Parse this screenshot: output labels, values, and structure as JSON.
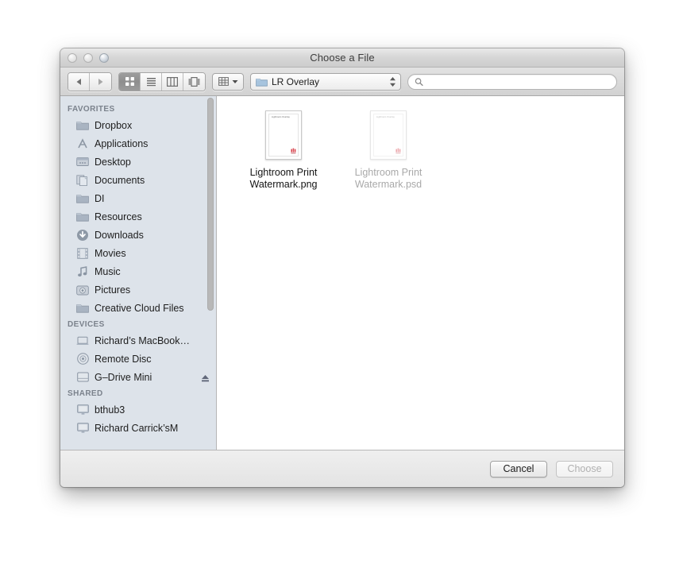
{
  "window": {
    "title": "Choose a File",
    "traffic_lights": [
      "close-button",
      "minimize-button",
      "zoom-button"
    ]
  },
  "toolbar": {
    "nav": {
      "back_icon": "back-arrow-icon",
      "forward_icon": "forward-arrow-icon"
    },
    "view_modes": [
      {
        "name": "icon-view",
        "icon": "grid-icon",
        "selected": true
      },
      {
        "name": "list-view",
        "icon": "list-icon",
        "selected": false
      },
      {
        "name": "column-view",
        "icon": "columns-icon",
        "selected": false
      },
      {
        "name": "coverflow-view",
        "icon": "coverflow-icon",
        "selected": false
      }
    ],
    "arrange": {
      "icon": "arrange-grid-icon",
      "chevron": "chevron-down-icon"
    },
    "path": {
      "label": "LR Overlay",
      "icon": "folder-icon",
      "stepper": "up-down-arrows-icon"
    },
    "search": {
      "placeholder": "",
      "value": "",
      "icon": "search-icon"
    }
  },
  "sidebar": {
    "sections": [
      {
        "header": "FAVORITES",
        "items": [
          {
            "label": "Dropbox",
            "icon": "folder-icon"
          },
          {
            "label": "Applications",
            "icon": "applications-icon"
          },
          {
            "label": "Desktop",
            "icon": "desktop-icon"
          },
          {
            "label": "Documents",
            "icon": "documents-icon"
          },
          {
            "label": "DI",
            "icon": "folder-icon"
          },
          {
            "label": "Resources",
            "icon": "folder-icon"
          },
          {
            "label": "Downloads",
            "icon": "downloads-icon"
          },
          {
            "label": "Movies",
            "icon": "movies-icon"
          },
          {
            "label": "Music",
            "icon": "music-note-icon"
          },
          {
            "label": "Pictures",
            "icon": "pictures-icon"
          },
          {
            "label": "Creative Cloud Files",
            "icon": "folder-icon"
          }
        ]
      },
      {
        "header": "DEVICES",
        "items": [
          {
            "label": "Richard’s MacBook…",
            "icon": "laptop-icon"
          },
          {
            "label": "Remote Disc",
            "icon": "disc-icon"
          },
          {
            "label": "G–Drive Mini",
            "icon": "harddrive-icon",
            "eject": "eject-icon"
          }
        ]
      },
      {
        "header": "SHARED",
        "items": [
          {
            "label": "bthub3",
            "icon": "screen-icon"
          },
          {
            "label": "Richard Carrick’sM",
            "icon": "screen-icon"
          }
        ]
      }
    ]
  },
  "files": [
    {
      "name": "Lightroom Print Watermark.png",
      "thumb_title": "Lightroom Overlay",
      "disabled": false
    },
    {
      "name": "Lightroom Print Watermark.psd",
      "thumb_title": "Lightroom Overlay",
      "disabled": true
    }
  ],
  "footer": {
    "cancel_label": "Cancel",
    "choose_label": "Choose",
    "choose_disabled": true
  },
  "colors": {
    "sidebar_bg": "#dde3ea",
    "titlebar_bg": "#d6d6d6",
    "accent_mark": "#d94a53"
  }
}
